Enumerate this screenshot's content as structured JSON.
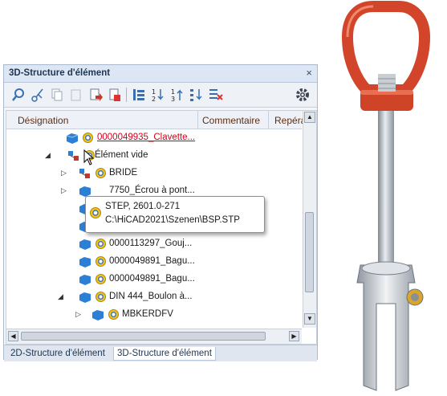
{
  "panel": {
    "title": "3D-Structure d'élément",
    "close_label": "×"
  },
  "toolbar": {
    "icons": [
      "search-icon",
      "scissors-icon",
      "copy-icon",
      "paste-icon",
      "export-icon",
      "delete-icon",
      "sort-asc-icon",
      "sort-desc-icon",
      "sort-up-icon",
      "sort-down-icon",
      "clear-filter-icon",
      "gear-icon"
    ]
  },
  "columns": {
    "designation": "Désignation",
    "comment": "Commentaire",
    "repere": "Repéra"
  },
  "rows": [
    {
      "label": "0000049935_Clavette...",
      "red": true
    },
    {
      "label": "Élément vide"
    },
    {
      "label": "BRIDE"
    },
    {
      "label": "7750_Écrou à pont..."
    },
    {
      "label": ""
    },
    {
      "label": ""
    },
    {
      "label": "0000113297_Gouj..."
    },
    {
      "label": "0000049891_Bagu..."
    },
    {
      "label": "0000049891_Bagu..."
    },
    {
      "label": "DIN 444_Boulon à..."
    },
    {
      "label": "MBKERDFV"
    }
  ],
  "tooltip": {
    "line1": "STEP, 2601.0-271",
    "line2": "C:\\HiCAD2021\\Szenen\\BSP.STP"
  },
  "tabs": {
    "tab1": "2D-Structure d'élément",
    "tab2": "3D-Structure d'élément"
  },
  "colors": {
    "link_red": "#d4001a",
    "cube_blue": "#2b7fd6",
    "model_red": "#d2452a"
  }
}
